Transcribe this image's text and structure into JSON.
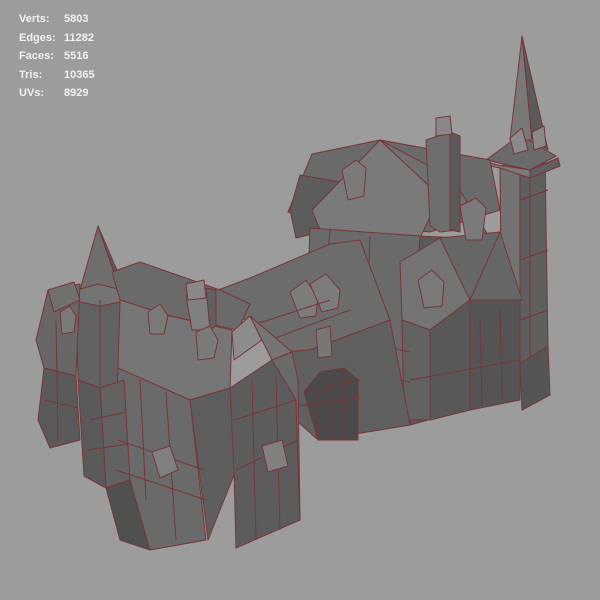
{
  "viewport": {
    "background": "#9c9c9c",
    "mesh_fill": "#6b6b6b",
    "wire_color": "#7a3535"
  },
  "stats": {
    "verts": {
      "label": "Verts:",
      "value": "5803"
    },
    "edges": {
      "label": "Edges:",
      "value": "11282"
    },
    "faces": {
      "label": "Faces:",
      "value": "5516"
    },
    "tris": {
      "label": "Tris:",
      "value": "10365"
    },
    "uvs": {
      "label": "UVs:",
      "value": "8929"
    }
  }
}
